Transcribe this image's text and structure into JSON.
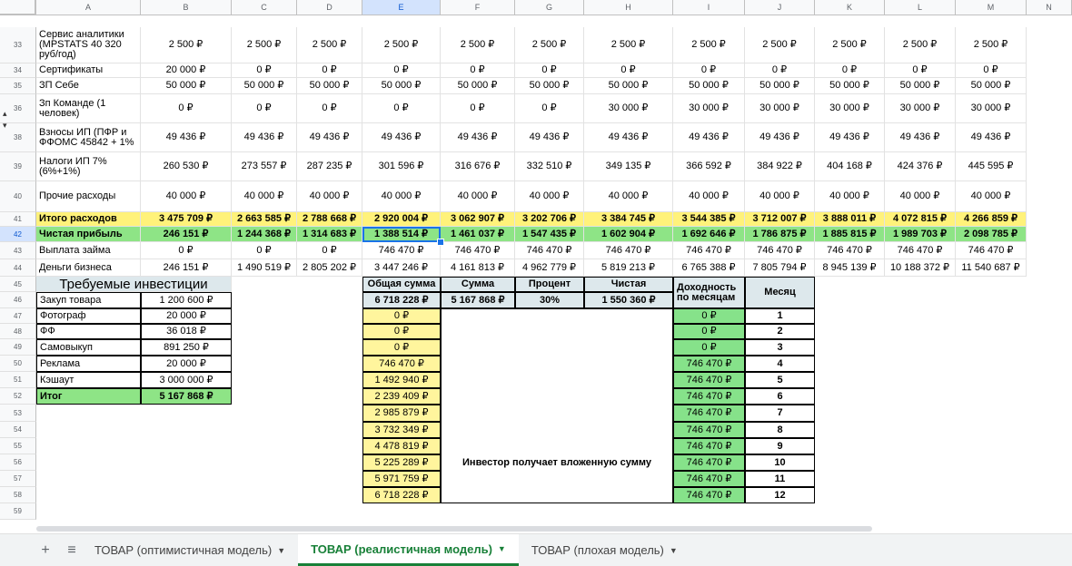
{
  "columns": [
    "A",
    "B",
    "C",
    "D",
    "E",
    "F",
    "G",
    "H",
    "I",
    "J",
    "K",
    "L",
    "M",
    "N"
  ],
  "rows": [
    "33",
    "34",
    "35",
    "36",
    "38",
    "39",
    "40",
    "41",
    "42",
    "43",
    "44",
    "45",
    "46",
    "47",
    "48",
    "49",
    "50",
    "51",
    "52",
    "53",
    "54",
    "55",
    "56",
    "57",
    "58",
    "59"
  ],
  "group_marks": [
    "▴",
    "▾"
  ],
  "table": [
    {
      "label": "Сервис аналитики (MPSTATS 40 320 руб/год)",
      "values": [
        "2 500 ₽",
        "2 500 ₽",
        "2 500 ₽",
        "2 500 ₽",
        "2 500 ₽",
        "2 500 ₽",
        "2 500 ₽",
        "2 500 ₽",
        "2 500 ₽",
        "2 500 ₽",
        "2 500 ₽",
        "2 500 ₽"
      ]
    },
    {
      "label": "Сертификаты",
      "values": [
        "20 000 ₽",
        "0 ₽",
        "0 ₽",
        "0 ₽",
        "0 ₽",
        "0 ₽",
        "0 ₽",
        "0 ₽",
        "0 ₽",
        "0 ₽",
        "0 ₽",
        "0 ₽"
      ]
    },
    {
      "label": "ЗП Себе",
      "values": [
        "50 000 ₽",
        "50 000 ₽",
        "50 000 ₽",
        "50 000 ₽",
        "50 000 ₽",
        "50 000 ₽",
        "50 000 ₽",
        "50 000 ₽",
        "50 000 ₽",
        "50 000 ₽",
        "50 000 ₽",
        "50 000 ₽"
      ]
    },
    {
      "label": "Зп Команде (1 человек)",
      "values": [
        "0 ₽",
        "0 ₽",
        "0 ₽",
        "0 ₽",
        "0 ₽",
        "0 ₽",
        "30 000 ₽",
        "30 000 ₽",
        "30 000 ₽",
        "30 000 ₽",
        "30 000 ₽",
        "30 000 ₽"
      ]
    },
    {
      "label": "Взносы ИП (ПФР и ФФОМС 45842 + 1%",
      "values": [
        "49 436 ₽",
        "49 436 ₽",
        "49 436 ₽",
        "49 436 ₽",
        "49 436 ₽",
        "49 436 ₽",
        "49 436 ₽",
        "49 436 ₽",
        "49 436 ₽",
        "49 436 ₽",
        "49 436 ₽",
        "49 436 ₽"
      ]
    },
    {
      "label": "Налоги ИП 7% (6%+1%)",
      "values": [
        "260 530 ₽",
        "273 557 ₽",
        "287 235 ₽",
        "301 596 ₽",
        "316 676 ₽",
        "332 510 ₽",
        "349 135 ₽",
        "366 592 ₽",
        "384 922 ₽",
        "404 168 ₽",
        "424 376 ₽",
        "445 595 ₽"
      ]
    },
    {
      "label": "Прочие расходы",
      "values": [
        "40 000 ₽",
        "40 000 ₽",
        "40 000 ₽",
        "40 000 ₽",
        "40 000 ₽",
        "40 000 ₽",
        "40 000 ₽",
        "40 000 ₽",
        "40 000 ₽",
        "40 000 ₽",
        "40 000 ₽",
        "40 000 ₽"
      ]
    },
    {
      "label": "Итого расходов",
      "values": [
        "3 475 709 ₽",
        "2 663 585 ₽",
        "2 788 668 ₽",
        "2 920 004 ₽",
        "3 062 907 ₽",
        "3 202 706 ₽",
        "3 384 745 ₽",
        "3 544 385 ₽",
        "3 712 007 ₽",
        "3 888 011 ₽",
        "4 072 815 ₽",
        "4 266 859 ₽"
      ]
    },
    {
      "label": "Чистая прибыль",
      "values": [
        "246 151 ₽",
        "1 244 368 ₽",
        "1 314 683 ₽",
        "1 388 514 ₽",
        "1 461 037 ₽",
        "1 547 435 ₽",
        "1 602 904 ₽",
        "1 692 646 ₽",
        "1 786 875 ₽",
        "1 885 815 ₽",
        "1 989 703 ₽",
        "2 098 785 ₽"
      ]
    },
    {
      "label": "Выплата займа",
      "values": [
        "0 ₽",
        "0 ₽",
        "0 ₽",
        "746 470 ₽",
        "746 470 ₽",
        "746 470 ₽",
        "746 470 ₽",
        "746 470 ₽",
        "746 470 ₽",
        "746 470 ₽",
        "746 470 ₽",
        "746 470 ₽"
      ]
    },
    {
      "label": "Деньги бизнеса",
      "values": [
        "246 151 ₽",
        "1 490 519 ₽",
        "2 805 202 ₽",
        "3 447 246 ₽",
        "4 161 813 ₽",
        "4 962 779 ₽",
        "5 819 213 ₽",
        "6 765 388 ₽",
        "7 805 794 ₽",
        "8 945 139 ₽",
        "10 188 372 ₽",
        "11 540 687 ₽"
      ]
    }
  ],
  "investment": {
    "title": "Требуемые инвестиции",
    "items": [
      {
        "label": "Закуп товара",
        "value": "1 200 600 ₽"
      },
      {
        "label": "Фотограф",
        "value": "20 000 ₽"
      },
      {
        "label": "ФФ",
        "value": "36 018 ₽"
      },
      {
        "label": "Самовыкуп",
        "value": "891 250 ₽"
      },
      {
        "label": "Реклама",
        "value": "20 000 ₽"
      },
      {
        "label": "Кэшаут",
        "value": "3 000 000 ₽"
      },
      {
        "label": "Итог",
        "value": "5 167 868 ₽"
      }
    ]
  },
  "investor": {
    "headers": [
      "Общая сумма",
      "Сумма",
      "Процент",
      "Чистая",
      "Доходность по месяцам",
      "Месяц"
    ],
    "summary": [
      "6 718 228 ₽",
      "5 167 868 ₽",
      "30%",
      "1 550 360 ₽"
    ],
    "total_col": [
      "0 ₽",
      "0 ₽",
      "0 ₽",
      "746 470 ₽",
      "1 492 940 ₽",
      "2 239 409 ₽",
      "2 985 879 ₽",
      "3 732 349 ₽",
      "4 478 819 ₽",
      "5 225 289 ₽",
      "5 971 759 ₽",
      "6 718 228 ₽"
    ],
    "monthly_col": [
      "0 ₽",
      "0 ₽",
      "0 ₽",
      "746 470 ₽",
      "746 470 ₽",
      "746 470 ₽",
      "746 470 ₽",
      "746 470 ₽",
      "746 470 ₽",
      "746 470 ₽",
      "746 470 ₽",
      "746 470 ₽"
    ],
    "months": [
      "1",
      "2",
      "3",
      "4",
      "5",
      "6",
      "7",
      "8",
      "9",
      "10",
      "11",
      "12"
    ],
    "note": "Инвестор получает вложенную сумму"
  },
  "tabs": {
    "add_icon": "+",
    "list_icon": "≡",
    "dropdown_icon": "▼",
    "items": [
      {
        "label": "ТОВАР (оптимистичная модель)",
        "active": false
      },
      {
        "label": "ТОВАР (реалистичная модель)",
        "active": true
      },
      {
        "label": "ТОВАР (плохая модель)",
        "active": false
      }
    ]
  },
  "colors": {
    "total_row": "#fff27a",
    "profit_row": "#8ee486",
    "header_fill": "#dde8ec",
    "accent": "#188038",
    "selection": "#1a73e8"
  }
}
